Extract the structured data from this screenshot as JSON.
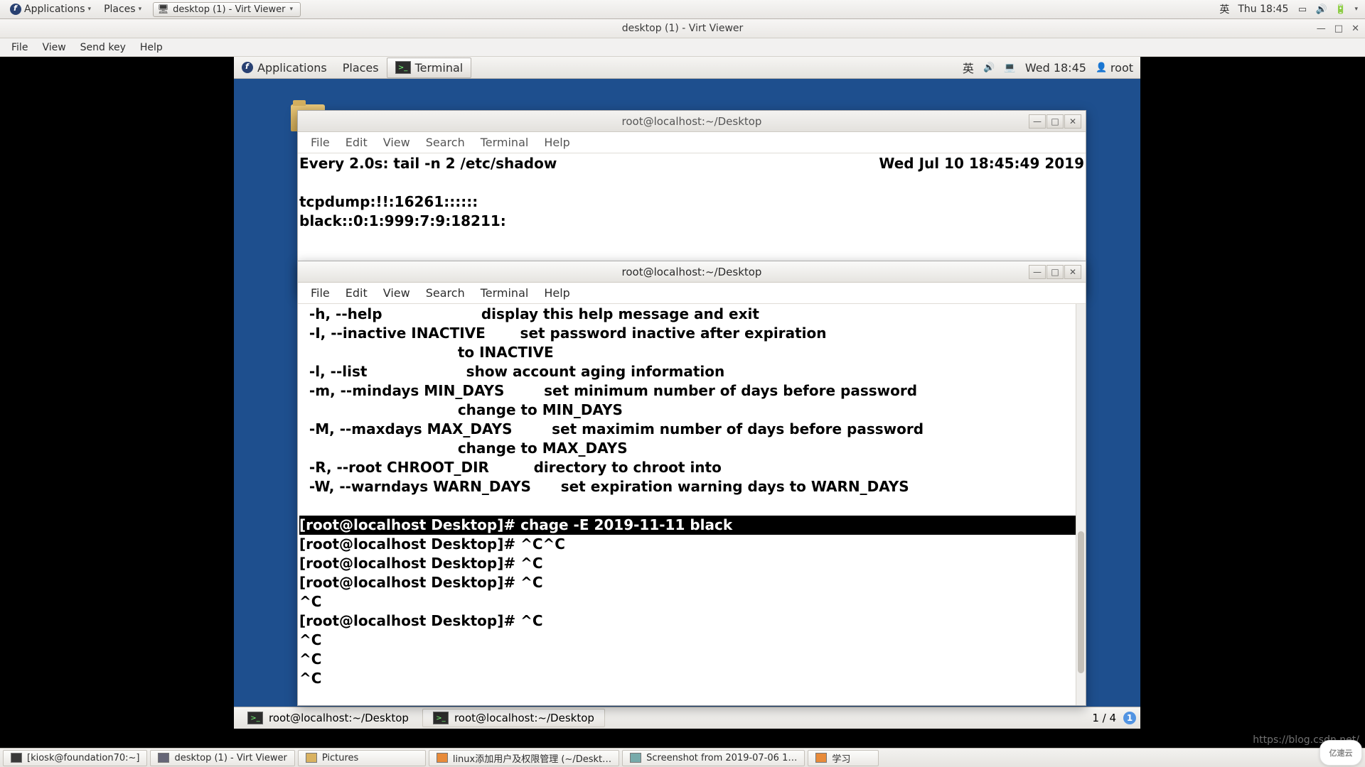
{
  "outer_panel": {
    "applications": "Applications",
    "places": "Places",
    "task": "desktop (1) - Virt Viewer",
    "ime": "英",
    "clock": "Thu 18:45"
  },
  "virt_window": {
    "title": "desktop (1) - Virt Viewer",
    "menu": {
      "file": "File",
      "view": "View",
      "sendkey": "Send key",
      "help": "Help"
    }
  },
  "guest_panel": {
    "applications": "Applications",
    "places": "Places",
    "terminal": "Terminal",
    "ime": "英",
    "clock": "Wed 18:45",
    "user_icon": "👤",
    "user": "root"
  },
  "term_menu": {
    "file": "File",
    "edit": "Edit",
    "view": "View",
    "search": "Search",
    "terminal": "Terminal",
    "help": "Help"
  },
  "term_back": {
    "title": "root@localhost:~/Desktop",
    "line1_left": "Every 2.0s: tail -n 2 /etc/shadow",
    "line1_right": "Wed Jul 10 18:45:49 2019",
    "line3": "tcpdump:!!:16261::::::",
    "line4": "black::0:1:999:7:9:18211:"
  },
  "term_front": {
    "title": "root@localhost:~/Desktop",
    "help_lines": "  -h, --help                    display this help message and exit\n  -I, --inactive INACTIVE       set password inactive after expiration\n                                to INACTIVE\n  -l, --list                    show account aging information\n  -m, --mindays MIN_DAYS        set minimum number of days before password\n                                change to MIN_DAYS\n  -M, --maxdays MAX_DAYS        set maximim number of days before password\n                                change to MAX_DAYS\n  -R, --root CHROOT_DIR         directory to chroot into\n  -W, --warndays WARN_DAYS      set expiration warning days to WARN_DAYS\n",
    "highlight": "[root@localhost Desktop]# chage -E 2019-11-11 black",
    "after": "[root@localhost Desktop]# ^C^C\n[root@localhost Desktop]# ^C\n[root@localhost Desktop]# ^C\n^C\n[root@localhost Desktop]# ^C\n^C\n^C\n^C"
  },
  "guest_bottom": {
    "task1": "root@localhost:~/Desktop",
    "task2": "root@localhost:~/Desktop",
    "workspace": "1 / 4",
    "ws_badge": "1"
  },
  "outer_taskbar": {
    "t1": "[kiosk@foundation70:~]",
    "t2": "desktop (1) - Virt Viewer",
    "t3": "Pictures",
    "t4": "linux添加用户及权限管理 (~/Deskt…",
    "t5": "Screenshot from 2019-07-06 1…",
    "t6": "学习"
  },
  "watermark": "https://blog.csdn.net/",
  "logo": "亿速云"
}
